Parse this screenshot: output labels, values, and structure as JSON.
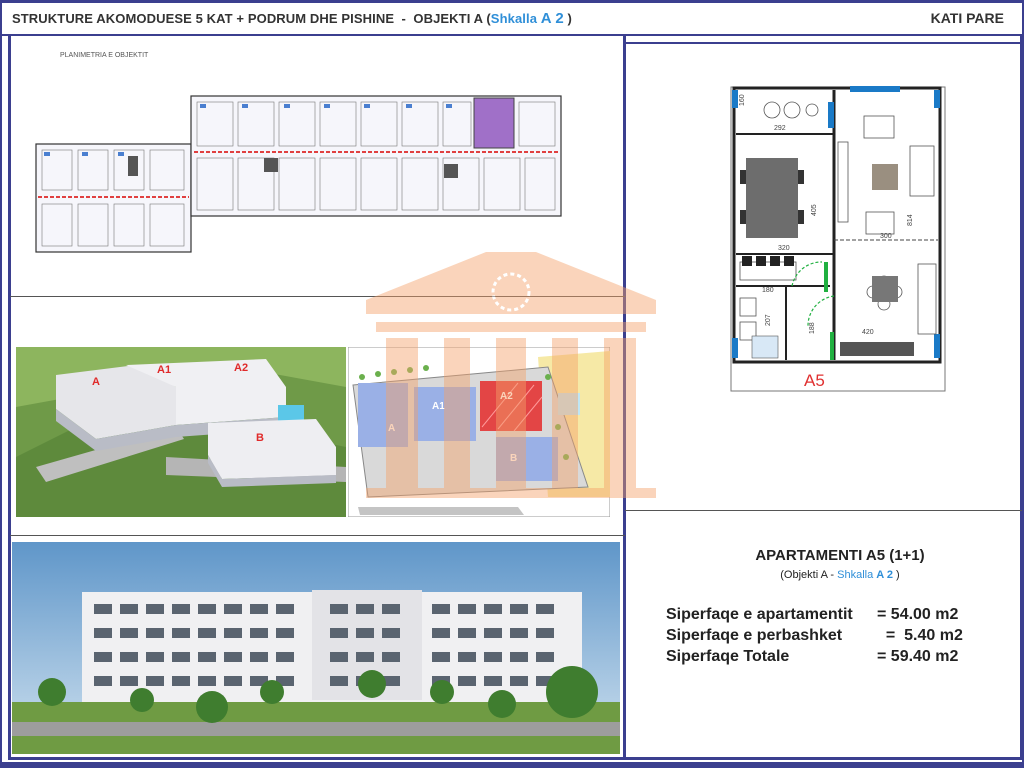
{
  "header": {
    "title_main": "STRUKTURE AKOMODUESE 5 KAT + PODRUM DHE PISHINE",
    "title_sep": "  -  OBJEKTI A (",
    "title_shkalla": "Shkalla",
    "title_code": "A 2",
    "title_close": " )",
    "floor": "KATI PARE"
  },
  "site_plan": {
    "label": "PLANIMETRIA E OBJEKTIT"
  },
  "aerial_render": {
    "labels": [
      "A",
      "A1",
      "A2",
      "B"
    ]
  },
  "site_map": {
    "labels": [
      "A",
      "A1",
      "A2",
      "B"
    ]
  },
  "unit_plan": {
    "unit_label": "A5",
    "dimensions": [
      "160",
      "292",
      "405",
      "300",
      "814",
      "320",
      "180",
      "207",
      "420",
      "188"
    ]
  },
  "apartment": {
    "title": "APARTAMENTI A5 (1+1)",
    "sub_open": "(Objekti A - ",
    "sub_shkalla": "Shkalla ",
    "sub_code": "A 2",
    "sub_close": " )",
    "areas": [
      {
        "label": "Siperfaqe e apartamentit",
        "value": "= 54.00 m2"
      },
      {
        "label": "Siperfaqe e perbashket",
        "value": "  =  5.40 m2"
      },
      {
        "label": "Siperfaqe Totale",
        "value": "= 59.40 m2"
      }
    ]
  },
  "colors": {
    "frame": "#3b3f8f",
    "accent_blue": "#2f8fd8",
    "unit_highlight": "#8a4fb3",
    "site_red": "#e0393a",
    "watermark": "#f4a26a"
  }
}
